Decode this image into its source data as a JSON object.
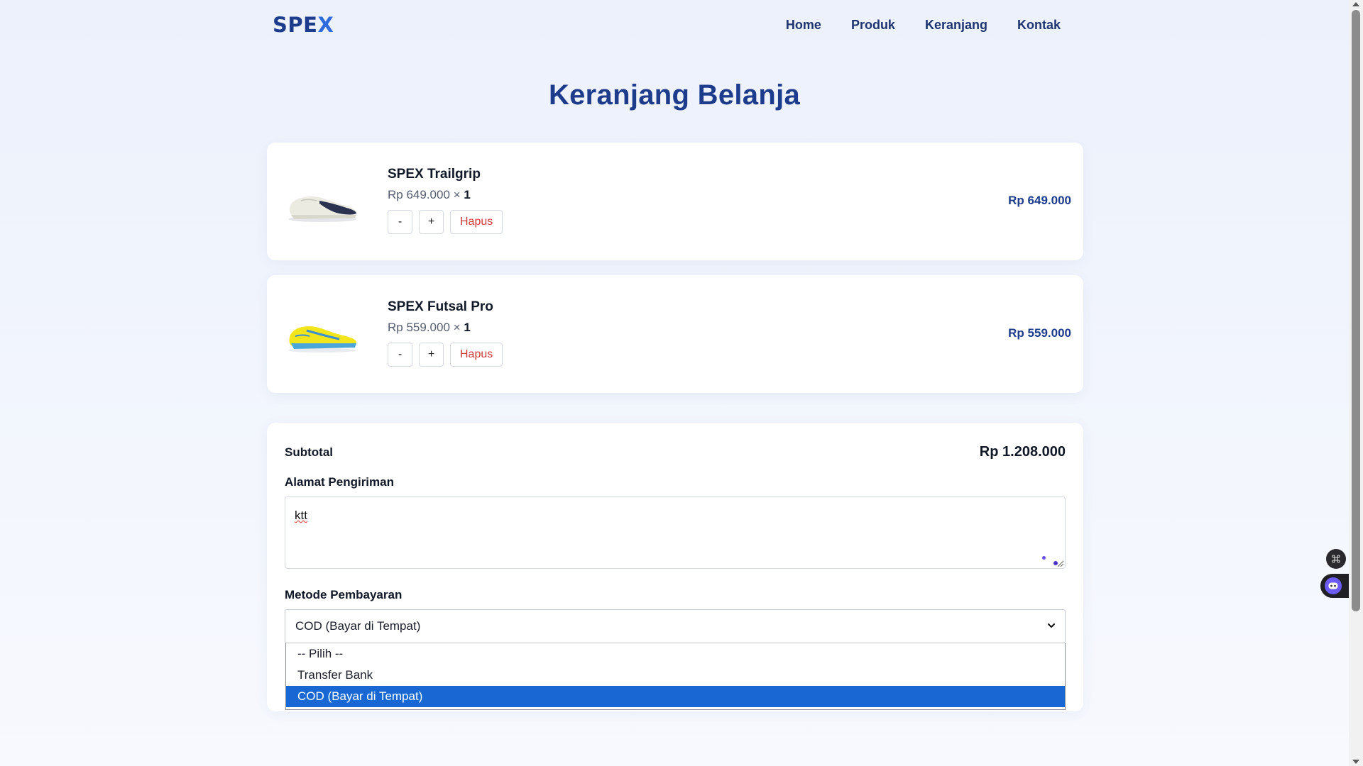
{
  "nav": {
    "logo_main": "SPE",
    "logo_accent": "X",
    "links": [
      "Home",
      "Produk",
      "Keranjang",
      "Kontak"
    ]
  },
  "page_title": "Keranjang Belanja",
  "cart": {
    "items": [
      {
        "name": "SPEX Trailgrip",
        "unit_price": "Rp 649.000",
        "times": "×",
        "qty": "1",
        "minus": "-",
        "plus": "+",
        "remove": "Hapus",
        "total": "Rp 649.000",
        "image_icon": "sneaker-white-icon"
      },
      {
        "name": "SPEX Futsal Pro",
        "unit_price": "Rp 559.000",
        "times": "×",
        "qty": "1",
        "minus": "-",
        "plus": "+",
        "remove": "Hapus",
        "total": "Rp 559.000",
        "image_icon": "sneaker-yellow-icon"
      }
    ]
  },
  "summary": {
    "subtotal_label": "Subtotal",
    "subtotal_value": "Rp 1.208.000",
    "address_label": "Alamat Pengiriman",
    "address_value": "ktt",
    "payment_label": "Metode Pembayaran",
    "payment_selected": "COD (Bayar di Tempat)",
    "payment_options": [
      "-- Pilih --",
      "Transfer Bank",
      "COD (Bayar di Tempat)"
    ]
  },
  "colors": {
    "brand": "#1e3c8c",
    "accent": "#2f6bdc",
    "danger": "#d23a3a",
    "selected_option": "#1967d2"
  }
}
